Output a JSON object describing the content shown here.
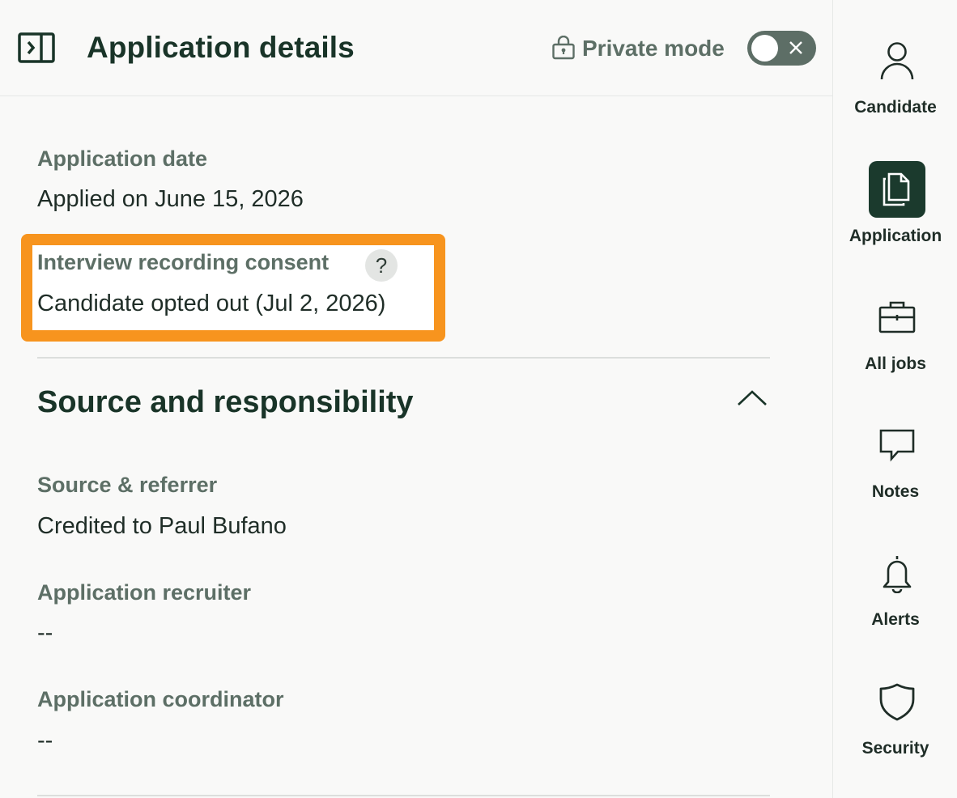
{
  "header": {
    "title": "Application details",
    "private_mode_label": "Private mode",
    "private_mode_on": false
  },
  "fields": {
    "application_date": {
      "label": "Application date",
      "value": "Applied on June 15, 2026"
    },
    "recording_consent": {
      "label": "Interview recording consent",
      "help": "?",
      "value": "Candidate opted out (Jul 2, 2026)"
    }
  },
  "section": {
    "title": "Source and responsibility",
    "fields": {
      "source": {
        "label": "Source & referrer",
        "value": "Credited to Paul Bufano"
      },
      "recruiter": {
        "label": "Application recruiter",
        "value": "--"
      },
      "coordinator": {
        "label": "Application coordinator",
        "value": "--"
      }
    }
  },
  "nav": {
    "candidate": {
      "label": "Candidate",
      "icon": "person-icon"
    },
    "application": {
      "label": "Application",
      "icon": "documents-icon",
      "active": true
    },
    "all_jobs": {
      "label": "All jobs",
      "icon": "briefcase-icon"
    },
    "notes": {
      "label": "Notes",
      "icon": "speech-bubble-icon"
    },
    "alerts": {
      "label": "Alerts",
      "icon": "bell-icon"
    },
    "security": {
      "label": "Security",
      "icon": "shield-icon"
    }
  },
  "colors": {
    "highlight": "#f7941e",
    "active_nav_bg": "#1b3a2d",
    "title_text": "#193428",
    "label_text": "#5d6f66"
  }
}
